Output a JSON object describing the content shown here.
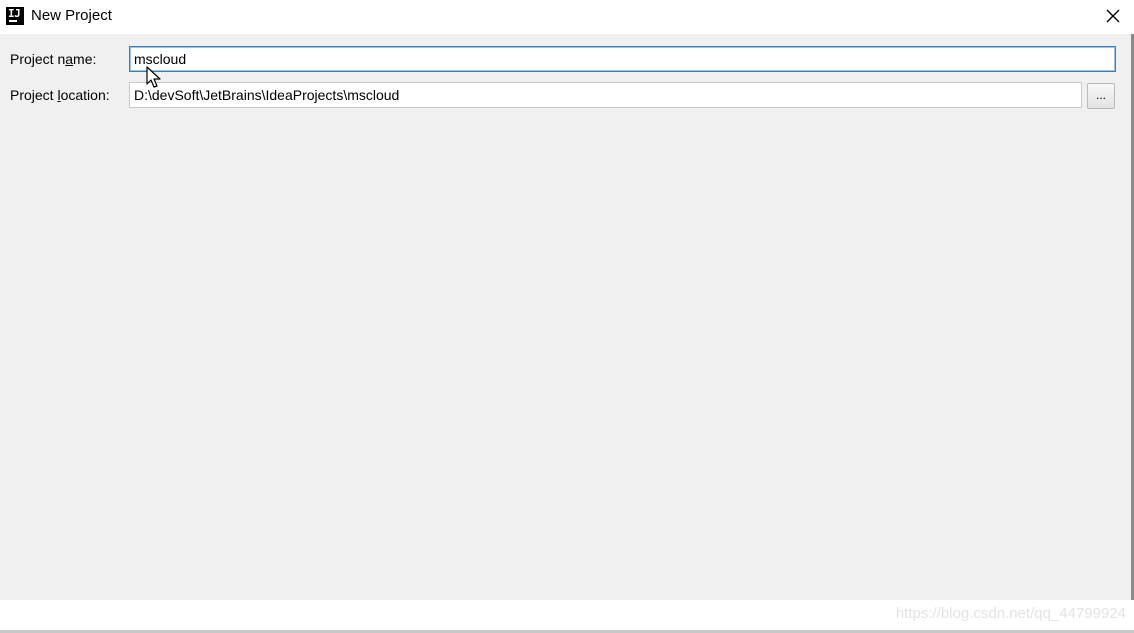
{
  "window": {
    "title": "New Project",
    "app_icon": "intellij-idea-icon",
    "close_icon": "close-icon"
  },
  "form": {
    "project_name": {
      "label_before": "Project n",
      "label_mnemonic": "a",
      "label_after": "me:",
      "value": "mscloud"
    },
    "project_location": {
      "label_before": "Project ",
      "label_mnemonic": "l",
      "label_after": "ocation:",
      "value": "D:\\devSoft\\JetBrains\\IdeaProjects\\mscloud",
      "browse_label": "..."
    }
  },
  "watermark": "https://blog.csdn.net/qq_44799924",
  "colors": {
    "content_background": "#f0f0f0",
    "focused_border": "#3c7fb1",
    "field_border": "#c8c8c8"
  }
}
